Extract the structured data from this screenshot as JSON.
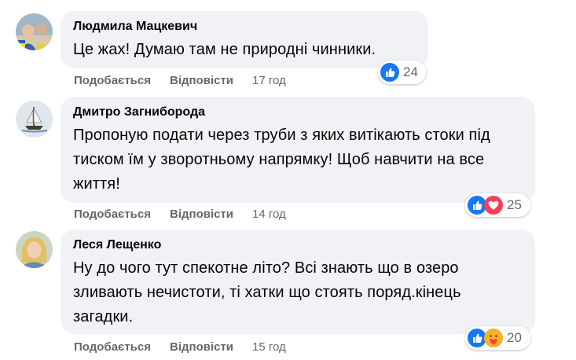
{
  "comments": [
    {
      "author": "Людмила Мацкевич",
      "text": "Це жах! Думаю там не природні чинники.",
      "like_label": "Подобається",
      "reply_label": "Відповісти",
      "time": "17 год",
      "reaction_count": "24",
      "reactions": [
        "like-icon"
      ]
    },
    {
      "author": "Дмитро Загнибородa",
      "text": "Пропоную подати через труби з яких витікають стоки під тиском їм у зворотньому напрямку! Щоб навчити на все життя!",
      "like_label": "Подобається",
      "reply_label": "Відповісти",
      "time": "14 год",
      "reaction_count": "25",
      "reactions": [
        "like-icon",
        "love-icon"
      ]
    },
    {
      "author": "Леся Лещенко",
      "text": "Ну до чого тут спекотне літо? Всі знають що в озеро зливають нечистоти, ті хатки що стоять поряд.кінець загадки.",
      "like_label": "Подобається",
      "reply_label": "Відповісти",
      "time": "15 год",
      "reaction_count": "20",
      "reactions": [
        "like-icon",
        "care-icon"
      ]
    }
  ],
  "colors": {
    "bubble": "#f0f2f5",
    "secondary_text": "#65676b",
    "like_blue": "#1877f2",
    "love_red": "#f33e58",
    "care_yellow": "#f7b125"
  }
}
